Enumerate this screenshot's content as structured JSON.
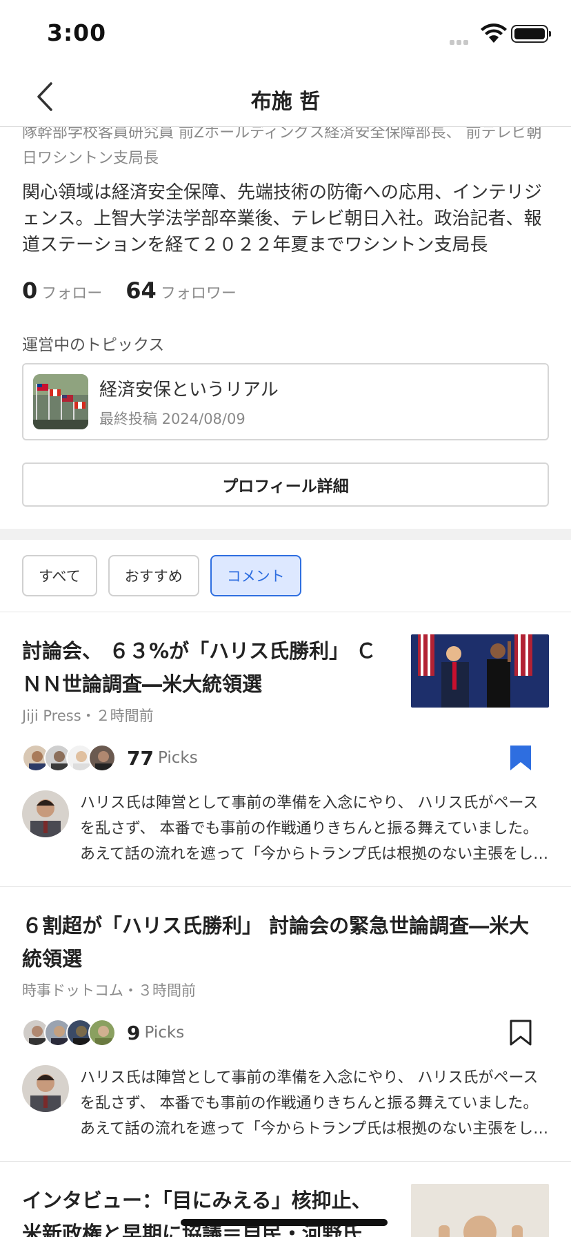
{
  "status_bar": {
    "time": "3:00"
  },
  "nav": {
    "title": "布施 哲"
  },
  "profile": {
    "affiliation": "隊幹部学校客員研究員 前Zホールディングス経済安全保障部長、 前テレビ朝日ワシントン支局長",
    "bio": "関心領域は経済安全保障、先端技術の防衛への応用、インテリジェンス。上智大学法学部卒業後、テレビ朝日入社。政治記者、報道ステーションを経て２０２２年夏までワシントン支局長",
    "following_count": "0",
    "following_label": "フォロー",
    "followers_count": "64",
    "followers_label": "フォロワー",
    "topics_heading": "運営中のトピックス",
    "topic": {
      "title": "経済安保というリアル",
      "meta": "最終投稿 2024/08/09"
    },
    "detail_button": "プロフィール詳細"
  },
  "filter_tabs": [
    {
      "label": "すべて",
      "active": false
    },
    {
      "label": "おすすめ",
      "active": false
    },
    {
      "label": "コメント",
      "active": true
    }
  ],
  "articles": [
    {
      "title": "討論会、 ６３%が「ハリス氏勝利」 ＣＮＮ世論調査―米大統領選",
      "source": "Jiji Press・２時間前",
      "picks_count": "77",
      "picks_label": "Picks",
      "bookmarked": true,
      "comment": "ハリス氏は陣営として事前の準備を入念にやり、 ハリス氏がペースを乱さず、 本番でも事前の作戦通りきちんと振る舞えていました。　あえて話の流れを遮って「今からトランプ氏は根拠のない主張をします」"
    },
    {
      "title": "６割超が「ハリス氏勝利」 討論会の緊急世論調査―米大統領選",
      "source": "時事ドットコム・３時間前",
      "picks_count": "9",
      "picks_label": "Picks",
      "bookmarked": false,
      "comment": "ハリス氏は陣営として事前の準備を入念にやり、 ハリス氏がペースを乱さず、 本番でも事前の作戦通りきちんと振る舞えていました。　あえて話の流れを遮って「今からトランプ氏は根拠のない主張をします」"
    },
    {
      "title": "インタビュー：「目にみえる」核抑止、米新政権と早期に協議＝自民・河野氏"
    }
  ],
  "colors": {
    "accent": "#2e6ee0",
    "tab_active_bg": "#dde8ff",
    "bookmark": "#2e6ee0"
  }
}
